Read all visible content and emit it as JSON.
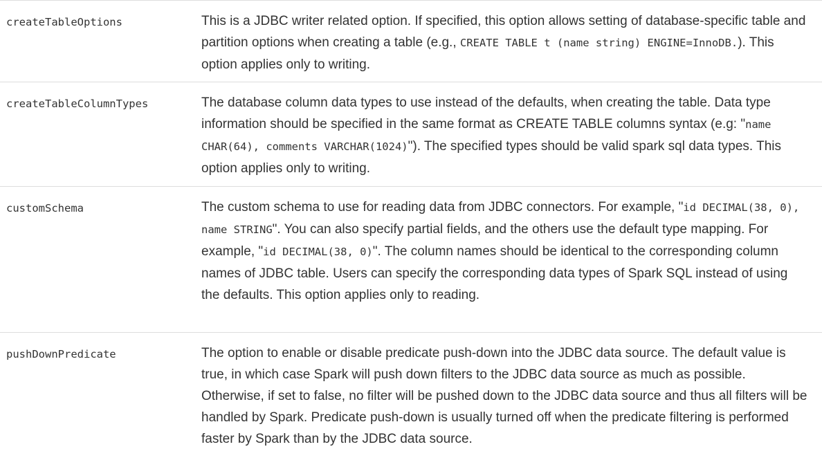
{
  "rows": [
    {
      "name": "createTableOptions",
      "desc": {
        "t1": "This is a JDBC writer related option. If specified, this option allows setting of database-specific table and partition options when creating a table (e.g., ",
        "c1": "CREATE TABLE t (name string) ENGINE=InnoDB.",
        "t2": "). This option applies only to writing."
      }
    },
    {
      "name": "createTableColumnTypes",
      "desc": {
        "t1": "The database column data types to use instead of the defaults, when creating the table. Data type information should be specified in the same format as CREATE TABLE columns syntax (e.g: \"",
        "c1": "name CHAR(64), comments VARCHAR(1024)",
        "t2": "\"). The specified types should be valid spark sql data types. This option applies only to writing."
      }
    },
    {
      "name": "customSchema",
      "desc": {
        "t1": "The custom schema to use for reading data from JDBC connectors. For example, \"",
        "c1": "id DECIMAL(38, 0), name STRING",
        "t2": "\". You can also specify partial fields, and the others use the default type mapping. For example, \"",
        "c2": "id DECIMAL(38, 0)",
        "t3": "\". The column names should be identical to the corresponding column names of JDBC table. Users can specify the corresponding data types of Spark SQL instead of using the defaults. This option applies only to reading."
      }
    },
    {
      "name": "pushDownPredicate",
      "desc": {
        "t1": "The option to enable or disable predicate push-down into the JDBC data source. The default value is true, in which case Spark will push down filters to the JDBC data source as much as possible. Otherwise, if set to false, no filter will be pushed down to the JDBC data source and thus all filters will be handled by Spark. Predicate push-down is usually turned off when the predicate filtering is performed faster by Spark than by the JDBC data source."
      }
    }
  ]
}
